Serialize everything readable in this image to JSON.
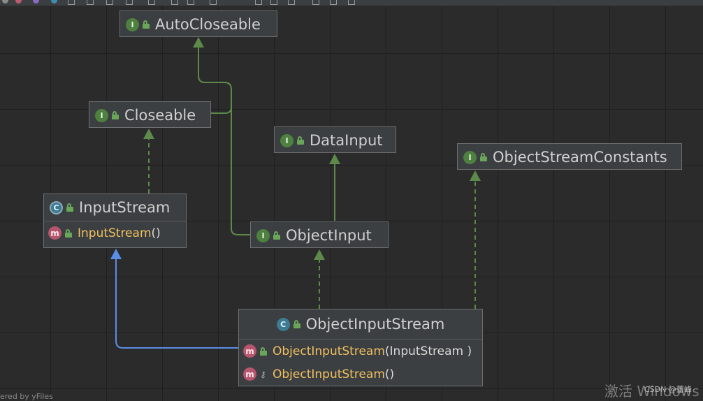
{
  "colors": {
    "background": "#2b2b2b",
    "node_fill": "#3c3f41",
    "implements_edge": "#5d8a4a",
    "extends_edge": "#5b8ee6",
    "member_name": "#f0c060"
  },
  "nodes": {
    "auto_closeable": {
      "badge": "I",
      "badge_icon": "interface-icon",
      "name": "AutoCloseable"
    },
    "closeable": {
      "badge": "I",
      "badge_icon": "interface-icon",
      "name": "Closeable"
    },
    "data_input": {
      "badge": "I",
      "badge_icon": "interface-icon",
      "name": "DataInput"
    },
    "object_stream_constants": {
      "badge": "I",
      "badge_icon": "interface-icon",
      "name": "ObjectStreamConstants"
    },
    "input_stream": {
      "badge": "C",
      "badge_icon": "abstract-class-icon",
      "name": "InputStream",
      "members": [
        {
          "badge": "m",
          "name": "InputStream",
          "params": " ()",
          "visibility": "public"
        }
      ]
    },
    "object_input": {
      "badge": "I",
      "badge_icon": "interface-icon",
      "name": "ObjectInput"
    },
    "object_input_stream": {
      "badge": "C",
      "badge_icon": "class-icon",
      "name": "ObjectInputStream",
      "members": [
        {
          "badge": "m",
          "name": "ObjectInputStream",
          "params": " (InputStream )",
          "visibility": "public"
        },
        {
          "badge": "m",
          "name": "ObjectInputStream",
          "params": " ()",
          "visibility": "protected"
        }
      ]
    }
  },
  "footer": {
    "text": "ered by yFiles"
  },
  "watermark": {
    "text": "激活 Windows",
    "csdn": "CSDN @蕾峰"
  }
}
